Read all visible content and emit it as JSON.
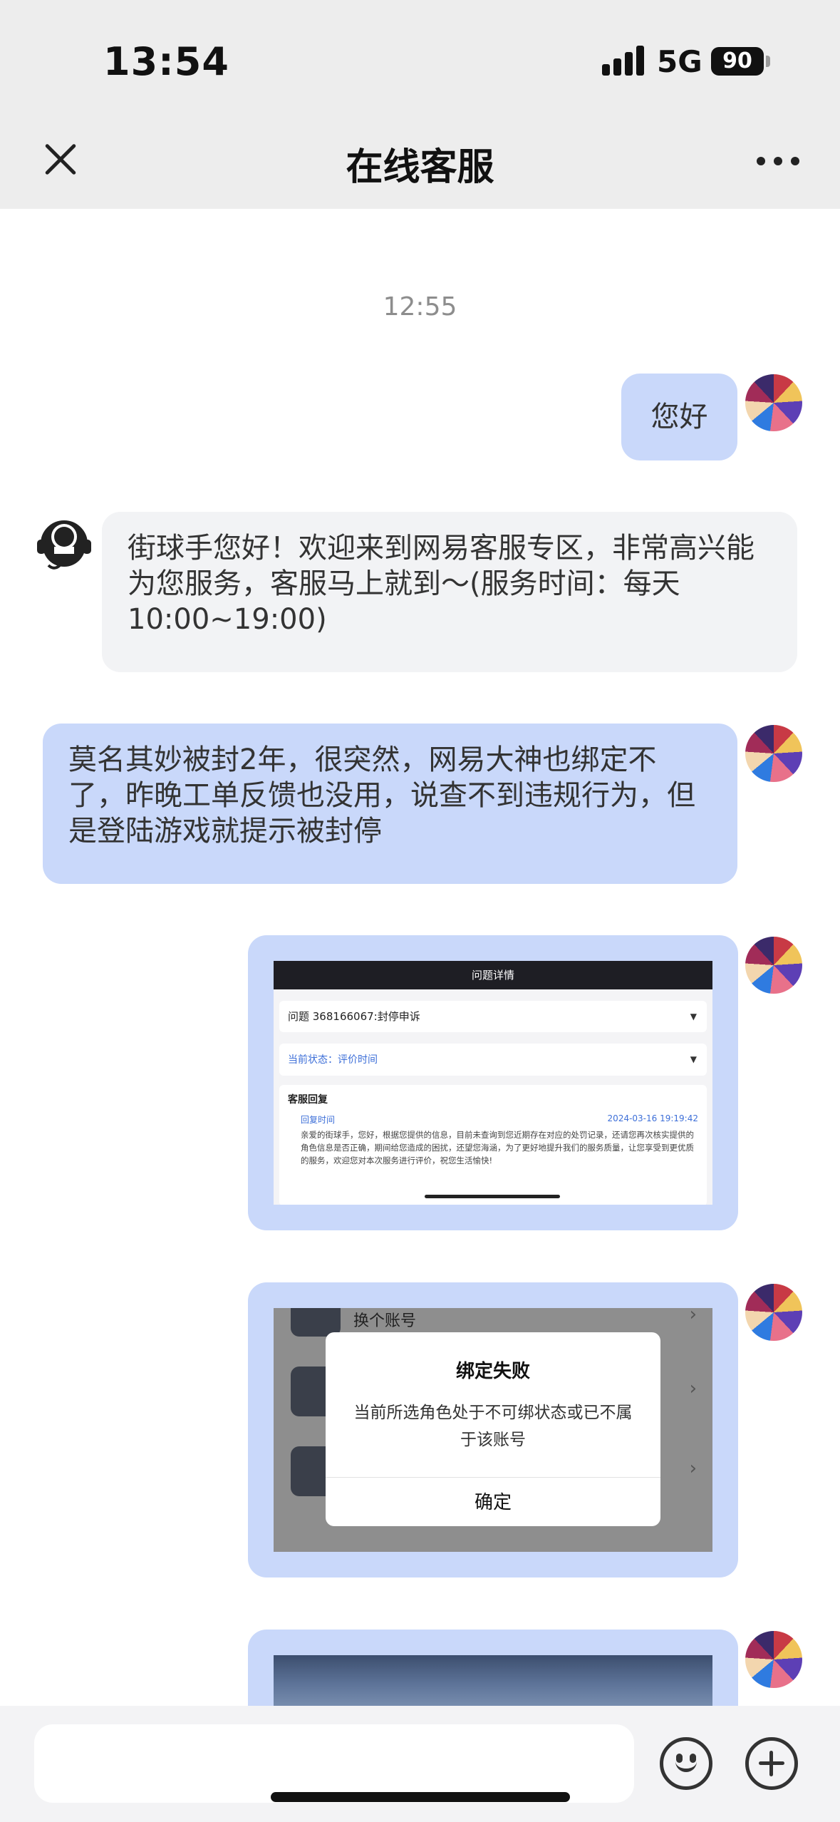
{
  "status_bar": {
    "time": "13:54",
    "network": "5G",
    "battery": "90"
  },
  "nav": {
    "title": "在线客服"
  },
  "chat": {
    "timestamp": "12:55",
    "messages": [
      {
        "from": "user",
        "text": "您好"
      },
      {
        "from": "agent",
        "text": "街球手您好！欢迎来到网易客服专区，非常高兴能为您服务，客服马上就到～(服务时间：每天10:00~19:00)"
      },
      {
        "from": "user",
        "text": "莫名其妙被封2年，很突然，网易大神也绑定不了，昨晚工单反馈也没用，说查不到违规行为，但是登陆游戏就提示被封停"
      }
    ],
    "image1": {
      "header": "问题详情",
      "row_issue": "问题 368166067:封停申诉",
      "row_status": "当前状态：评价时间",
      "reply_title": "客服回复",
      "reply_time_label": "回复时间",
      "reply_time_value": "2024-03-16 19:19:42",
      "reply_body": "亲爱的街球手，您好，根据您提供的信息，目前未查询到您近期存在对应的处罚记录，还请您再次核实提供的角色信息是否正确，期间给您造成的困扰，还望您海涵，为了更好地提升我们的服务质量，让您享受到更优质的服务，欢迎您对本次服务进行评价，祝您生活愉快!"
    },
    "image2": {
      "bg_label": "换个账号",
      "dialog_title": "绑定失败",
      "dialog_message": "当前所选角色处于不可绑状态或已不属于该账号",
      "dialog_button": "确定"
    }
  },
  "input": {
    "placeholder": ""
  },
  "icons": [
    "close-icon",
    "more-icon",
    "emoji-icon",
    "plus-icon",
    "signal-icon",
    "battery-icon",
    "headset-icon"
  ]
}
